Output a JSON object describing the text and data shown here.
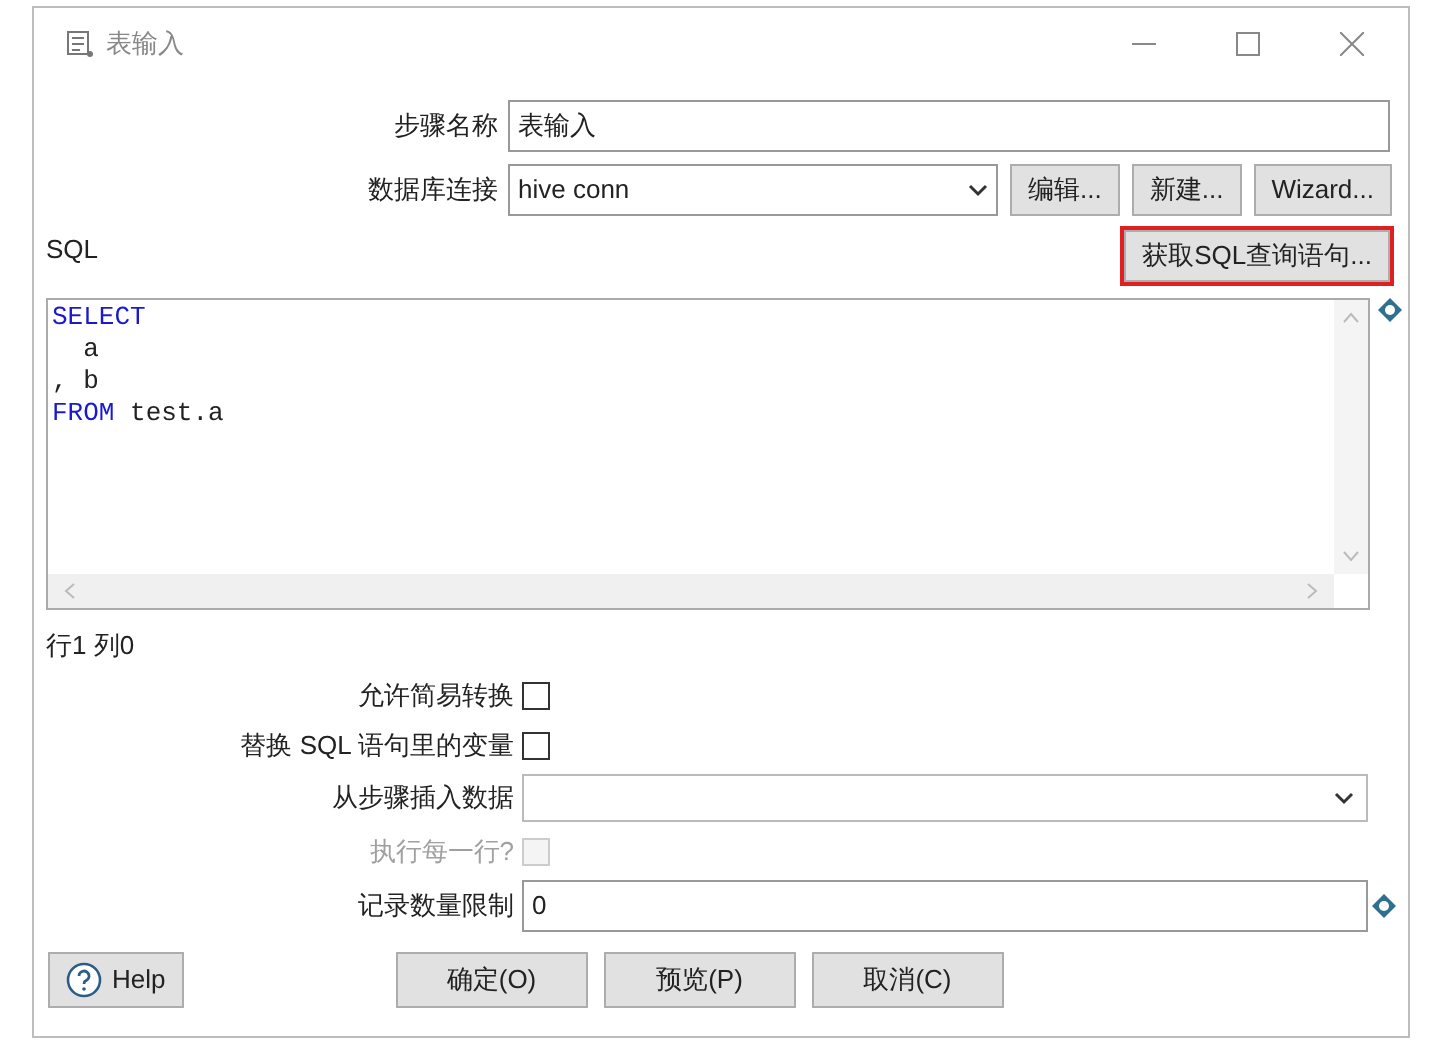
{
  "window": {
    "title": "表输入"
  },
  "step_name": {
    "label": "步骤名称",
    "value": "表输入"
  },
  "connection": {
    "label": "数据库连接",
    "value": "hive conn",
    "buttons": [
      "编辑...",
      "新建...",
      "Wizard..."
    ]
  },
  "sql": {
    "label": "SQL",
    "get_button": {
      "label": "获取SQL查询语句...",
      "highlighted": true
    },
    "lines": [
      [
        {
          "text": "SELECT",
          "kind": "keyword"
        }
      ],
      [
        {
          "text": "  a",
          "kind": "plain"
        }
      ],
      [
        {
          "text": ", b",
          "kind": "plain"
        }
      ],
      [
        {
          "text": "FROM",
          "kind": "keyword"
        },
        {
          "text": " test.a",
          "kind": "plain"
        }
      ]
    ]
  },
  "position": "行1 列0",
  "options": [
    {
      "kind": "checkbox",
      "label": "允许简易转换",
      "checked": false,
      "disabled": false
    },
    {
      "kind": "checkbox",
      "label": "替换 SQL 语句里的变量",
      "checked": false,
      "disabled": false
    },
    {
      "kind": "select",
      "label": "从步骤插入数据"
    },
    {
      "kind": "checkbox",
      "label": "执行每一行?",
      "checked": false,
      "disabled": true
    },
    {
      "kind": "text",
      "label": "记录数量限制",
      "value": "0",
      "variable": true
    }
  ],
  "help": "Help",
  "buttons": [
    "确定(O)",
    "预览(P)",
    "取消(C)"
  ]
}
